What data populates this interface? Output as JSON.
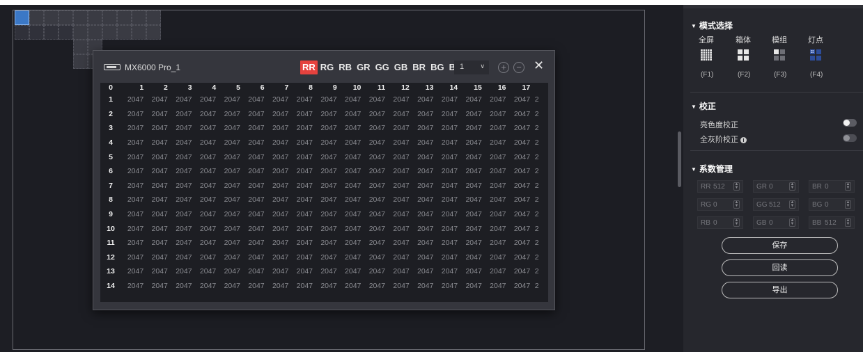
{
  "device": {
    "name": "MX6000 Pro_1"
  },
  "channels": [
    "RR",
    "RG",
    "RB",
    "GR",
    "GG",
    "GB",
    "BR",
    "BG",
    "BB"
  ],
  "active_channel": "RR",
  "page_select": {
    "value": "1"
  },
  "table": {
    "corner": "0",
    "columns": [
      "1",
      "2",
      "3",
      "4",
      "5",
      "6",
      "7",
      "8",
      "9",
      "10",
      "11",
      "12",
      "13",
      "14",
      "15",
      "16",
      "17"
    ],
    "overflow_marker": "2",
    "rows": [
      "1",
      "2",
      "3",
      "4",
      "5",
      "6",
      "7",
      "8",
      "9",
      "10",
      "11",
      "12",
      "13",
      "14"
    ],
    "cell_value": "2047"
  },
  "panel": {
    "mode_section": {
      "title": "模式选择",
      "modes": [
        {
          "label": "全屏",
          "key": "(F1)",
          "icon": "fullscreen-grid-icon"
        },
        {
          "label": "箱体",
          "key": "(F2)",
          "icon": "cabinet-grid-icon"
        },
        {
          "label": "模组",
          "key": "(F3)",
          "icon": "module-grid-icon"
        },
        {
          "label": "灯点",
          "key": "(F4)",
          "icon": "led-point-icon"
        }
      ]
    },
    "calib_section": {
      "title": "校正",
      "items": [
        {
          "label": "亮色度校正",
          "state": "on"
        },
        {
          "label": "全灰阶校正",
          "state": "off",
          "info": "i"
        }
      ]
    },
    "coef_section": {
      "title": "系数管理",
      "rows": [
        [
          {
            "label": "RR",
            "value": "512"
          },
          {
            "label": "GR",
            "value": "0"
          },
          {
            "label": "BR",
            "value": "0"
          }
        ],
        [
          {
            "label": "RG",
            "value": "0"
          },
          {
            "label": "GG",
            "value": "512"
          },
          {
            "label": "BG",
            "value": "0"
          }
        ],
        [
          {
            "label": "RB",
            "value": "0"
          },
          {
            "label": "GB",
            "value": "0"
          },
          {
            "label": "BB",
            "value": "512"
          }
        ]
      ]
    },
    "buttons": {
      "save": "保存",
      "readback": "回读",
      "export": "导出"
    }
  },
  "colors": {
    "accent": "#e5423e",
    "selected_tile": "#3b78c6"
  }
}
